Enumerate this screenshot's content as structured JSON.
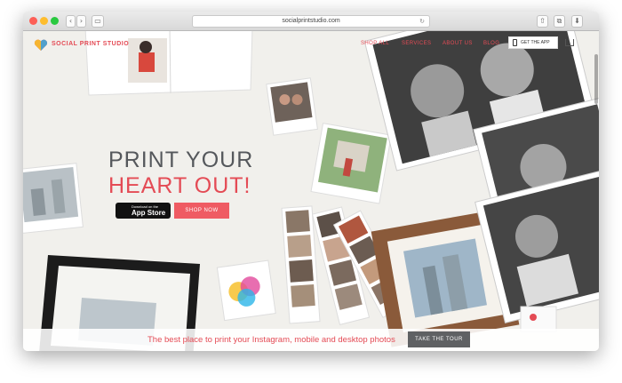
{
  "browser": {
    "url": "socialprintstudio.com",
    "back": "‹",
    "forward": "›",
    "sidebar": "▭",
    "reload": "↻",
    "share": "⇧",
    "tabs": "⧉",
    "downloads": "⬇",
    "lights": {
      "close": "#fd5f57",
      "minimize": "#febd2e",
      "zoom": "#29c940"
    }
  },
  "nav": {
    "brand": "SOCIAL PRINT STUDIO",
    "links": [
      "SHOP ALL",
      "SERVICES",
      "ABOUT US",
      "BLOG"
    ],
    "get_app": "GET THE APP"
  },
  "hero": {
    "line1": "PRINT YOUR",
    "line2": "HEART OUT!",
    "appstore_small": "Download on the",
    "appstore_big": "App Store",
    "shop_now": "SHOP NOW"
  },
  "footer_bar": {
    "tagline": "The best place to print your Instagram, mobile and desktop photos",
    "tour_button": "TAKE THE TOUR"
  },
  "colors": {
    "brand_red": "#e44b55",
    "button_red": "#ef5b63",
    "dark_gray": "#55585c",
    "tour_gray": "#5f6163"
  }
}
